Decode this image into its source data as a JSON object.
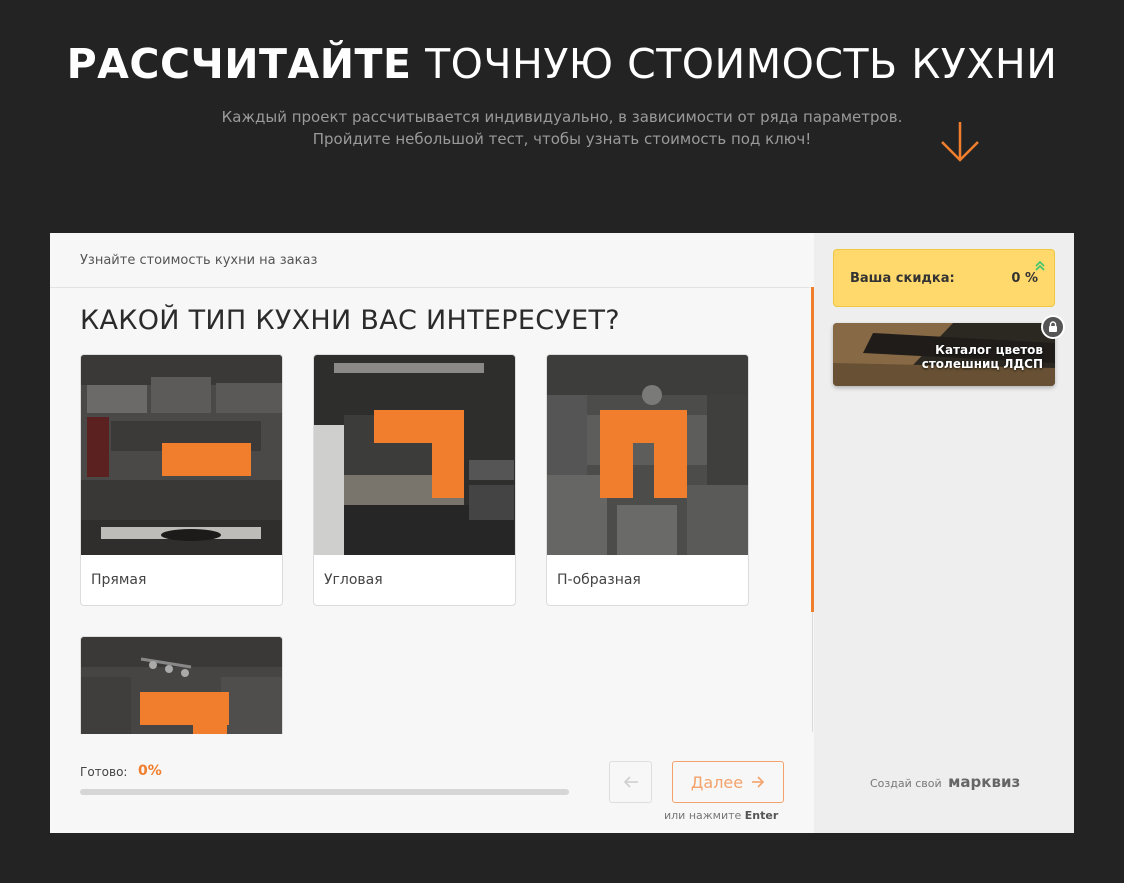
{
  "hero": {
    "title_bold": "РАССЧИТАЙТЕ",
    "title_rest": "ТОЧНУЮ СТОИМОСТЬ КУХНИ",
    "subtitle_line1": "Каждый проект рассчитывается индивидуально, в зависимости от ряда параметров.",
    "subtitle_line2": "Пройдите небольшой тест, чтобы узнать стоимость под ключ!",
    "arrow_icon": "arrow-down-icon"
  },
  "quiz": {
    "breadcrumb": "Узнайте стоимость кухни на заказ",
    "question": "КАКОЙ ТИП КУХНИ ВАС ИНТЕРЕСУЕТ?",
    "options": [
      {
        "label": "Прямая",
        "shape": "straight"
      },
      {
        "label": "Угловая",
        "shape": "corner"
      },
      {
        "label": "П-образная",
        "shape": "u-shaped"
      },
      {
        "label": "",
        "shape": "island"
      }
    ],
    "progress": {
      "label": "Готово:",
      "value": "0%",
      "fraction": 0
    },
    "nav": {
      "back_icon": "arrow-left-icon",
      "next_label": "Далее",
      "next_icon": "arrow-right-icon",
      "hint_prefix": "или нажмите",
      "hint_key": "Enter"
    }
  },
  "sidebar": {
    "discount_label": "Ваша скидка:",
    "discount_value": "0 %",
    "catalog_line1": "Каталог цветов",
    "catalog_line2": "столешниц ЛДСП",
    "powered_prefix": "Создай свой",
    "powered_brand": "марквиз"
  },
  "colors": {
    "accent": "#f07e2c",
    "discount_bg": "#ffd96b",
    "page_bg": "#232323"
  }
}
